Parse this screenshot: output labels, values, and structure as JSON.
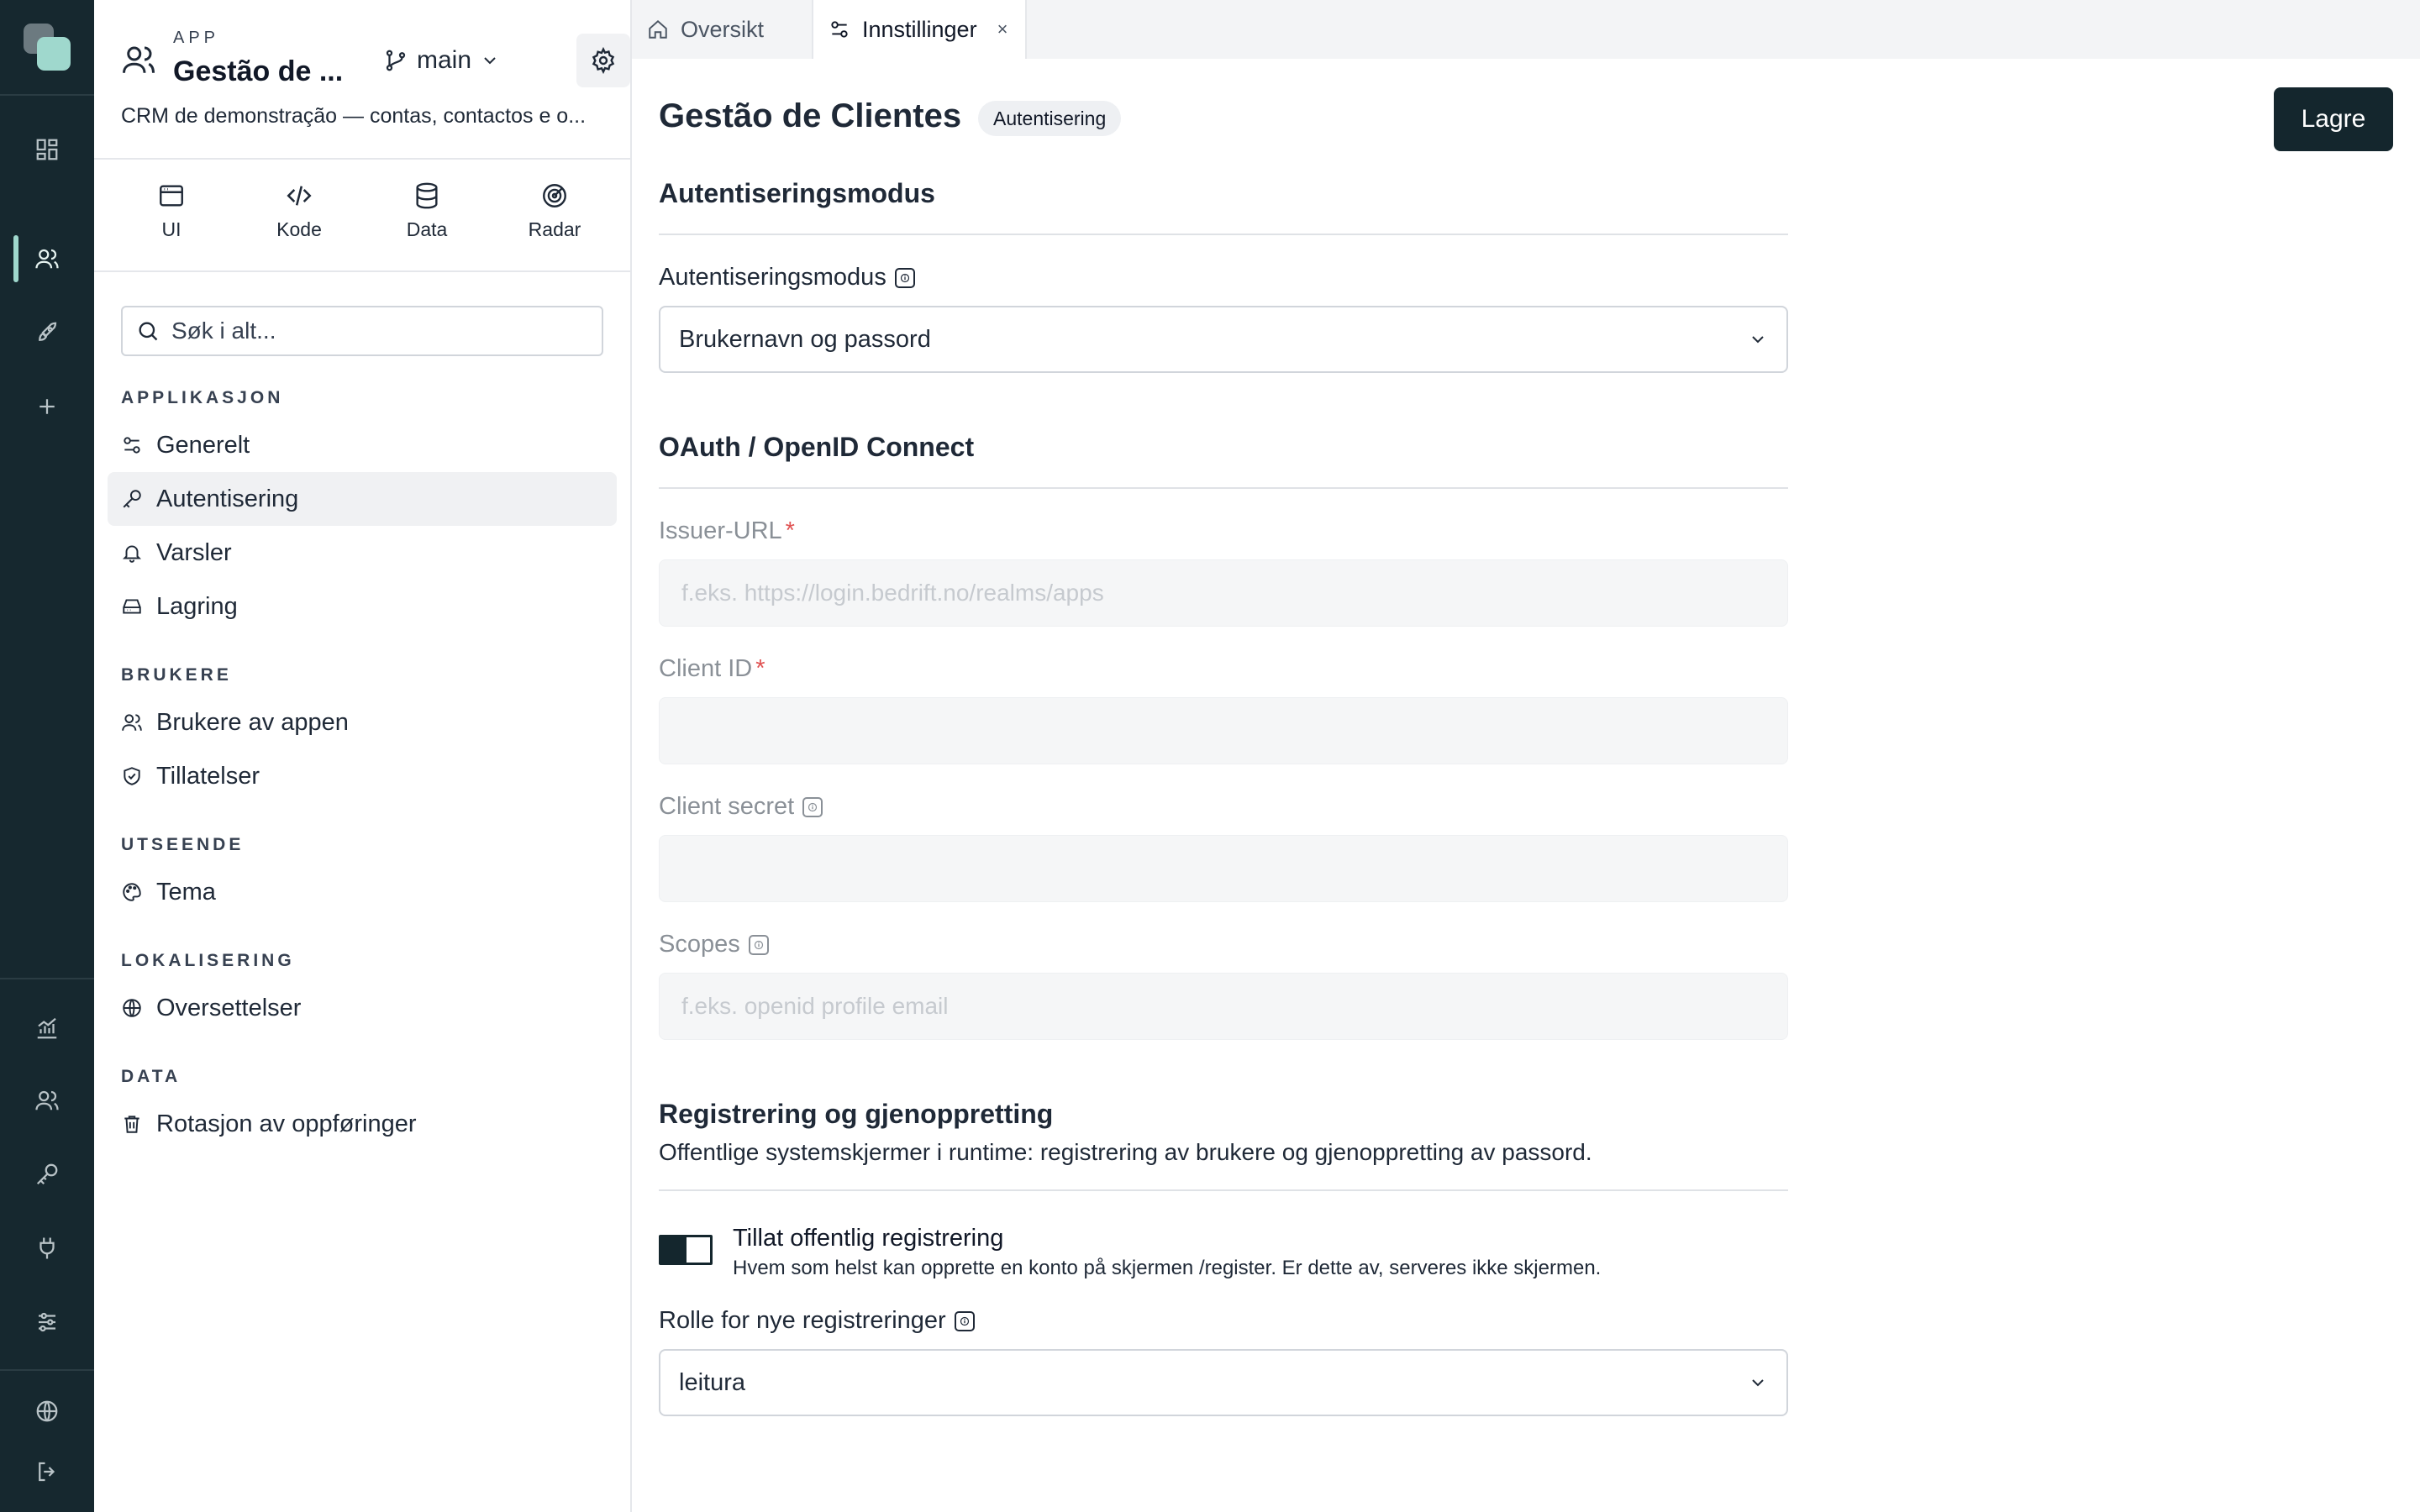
{
  "app": {
    "kicker": "APP",
    "name": "Gestão de ...",
    "branch": "main",
    "description": "CRM de demonstração — contas, contactos e o..."
  },
  "quick_links": [
    {
      "label": "UI",
      "icon": "window-icon"
    },
    {
      "label": "Kode",
      "icon": "code-icon"
    },
    {
      "label": "Data",
      "icon": "database-icon"
    },
    {
      "label": "Radar",
      "icon": "radar-icon"
    }
  ],
  "search": {
    "placeholder": "Søk i alt..."
  },
  "nav": {
    "sections": [
      {
        "title": "APPLIKASJON",
        "items": [
          "Generelt",
          "Autentisering",
          "Varsler",
          "Lagring"
        ]
      },
      {
        "title": "BRUKERE",
        "items": [
          "Brukere av appen",
          "Tillatelser"
        ]
      },
      {
        "title": "UTSEENDE",
        "items": [
          "Tema"
        ]
      },
      {
        "title": "LOKALISERING",
        "items": [
          "Oversettelser"
        ]
      },
      {
        "title": "DATA",
        "items": [
          "Rotasjon av oppføringer"
        ]
      }
    ],
    "active_item": "Autentisering"
  },
  "tabs": [
    {
      "label": "Oversikt",
      "icon": "home-icon",
      "active": false
    },
    {
      "label": "Innstillinger",
      "icon": "sliders-icon",
      "active": true,
      "close": "×"
    }
  ],
  "page": {
    "title": "Gestão de Clientes",
    "badge": "Autentisering",
    "save_label": "Lagre"
  },
  "auth_mode": {
    "section_title": "Autentiseringsmodus",
    "field_label": "Autentiseringsmodus",
    "value": "Brukernavn og passord"
  },
  "oauth": {
    "section_title": "OAuth / OpenID Connect",
    "issuer_label": "Issuer-URL",
    "issuer_placeholder": "f.eks. https://login.bedrift.no/realms/apps",
    "client_id_label": "Client ID",
    "client_id_value": "",
    "client_secret_label": "Client secret",
    "client_secret_value": "",
    "scopes_label": "Scopes",
    "scopes_placeholder": "f.eks. openid profile email",
    "required_mark": "*"
  },
  "registration": {
    "section_title": "Registrering og gjenoppretting",
    "description": "Offentlige systemskjermer i runtime: registrering av brukere og gjenoppretting av passord.",
    "toggle_label": "Tillat offentlig registrering",
    "toggle_help": "Hvem som helst kan opprette en konto på skjermen /register. Er dette av, serveres ikke skjermen.",
    "toggle_on": false,
    "role_label": "Rolle for nye registreringer",
    "role_value": "leitura"
  },
  "colors": {
    "rail_bg": "#16282f",
    "accent": "#9fd8cd",
    "primary_button": "#14262d",
    "required": "#e05252"
  }
}
